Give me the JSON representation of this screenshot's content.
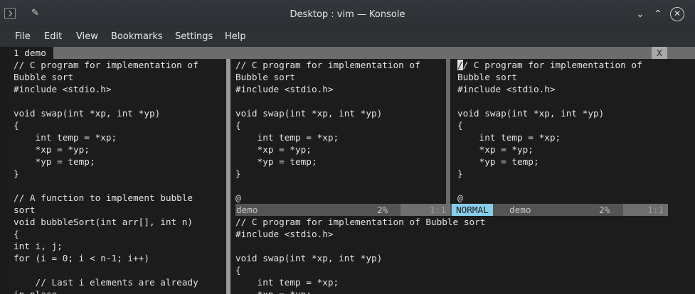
{
  "window": {
    "title": "Desktop : vim — Konsole",
    "minimize_glyph": "⌄",
    "maximize_glyph": "⌃",
    "close_glyph": "✕",
    "pin_glyph": "✎"
  },
  "menu": {
    "items": [
      "File",
      "Edit",
      "View",
      "Bookmarks",
      "Settings",
      "Help"
    ]
  },
  "vim": {
    "tab_label": "1 demo",
    "tab_close": "X",
    "left_pane_lines": [
      "// C program for implementation of",
      "Bubble sort",
      "#include <stdio.h>",
      "",
      "void swap(int *xp, int *yp)",
      "{",
      "    int temp = *xp;",
      "    *xp = *yp;",
      "    *yp = temp;",
      "}",
      "",
      "// A function to implement bubble",
      "sort",
      "void bubbleSort(int arr[], int n)",
      "{",
      "int i, j;",
      "for (i = 0; i < n-1; i++)",
      "",
      "    // Last i elements are already",
      "in place"
    ],
    "middle_pane_lines": [
      "// C program for implementation of",
      "Bubble sort",
      "#include <stdio.h>",
      "",
      "void swap(int *xp, int *yp)",
      "{",
      "    int temp = *xp;",
      "    *xp = *yp;",
      "    *yp = temp;",
      "}",
      "",
      "@"
    ],
    "right_pane_first_char": "/",
    "right_pane_first_rest": "/ C program for implementation of",
    "right_pane_lines": [
      "Bubble sort",
      "#include <stdio.h>",
      "",
      "void swap(int *xp, int *yp)",
      "{",
      "    int temp = *xp;",
      "    *xp = *yp;",
      "    *yp = temp;",
      "}",
      "",
      "@"
    ],
    "bottom_pane_lines": [
      "// C program for implementation of Bubble sort",
      "#include <stdio.h>",
      "",
      "void swap(int *xp, int *yp)",
      "{",
      "    int temp = *xp;",
      "    *xp = *yp;"
    ],
    "middle_status": {
      "filename": "demo",
      "percent": "2%",
      "position": "1:1"
    },
    "right_status": {
      "mode": "NORMAL",
      "filename": "demo",
      "percent": "2%",
      "position": "1:1"
    }
  }
}
